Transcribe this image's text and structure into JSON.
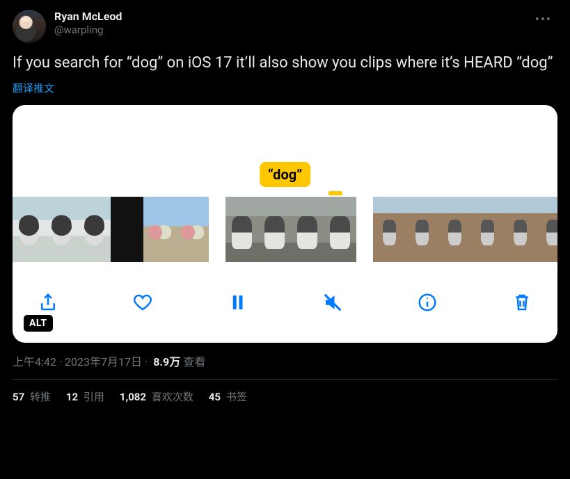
{
  "header": {
    "display_name": "Ryan McLeod",
    "handle": "@warpling"
  },
  "tweet": {
    "text": "If you search for “dog” on iOS 17 it’ll also show you clips where it’s HEARD “dog”",
    "translate_label": "翻译推文"
  },
  "media": {
    "highlight_label": "“dog”",
    "alt_badge": "ALT",
    "toolbar_icons": [
      "share",
      "heart",
      "pause",
      "mute",
      "info",
      "trash"
    ]
  },
  "meta": {
    "time": "上午4:42",
    "sep": " · ",
    "date": "2023年7月17日",
    "views_number": "8.9万",
    "views_label": " 查看"
  },
  "stats": {
    "retweets_num": "57",
    "retweets_label": " 转推",
    "quotes_num": "12",
    "quotes_label": " 引用",
    "likes_num": "1,082",
    "likes_label": " 喜欢次数",
    "bookmarks_num": "45",
    "bookmarks_label": " 书签"
  }
}
